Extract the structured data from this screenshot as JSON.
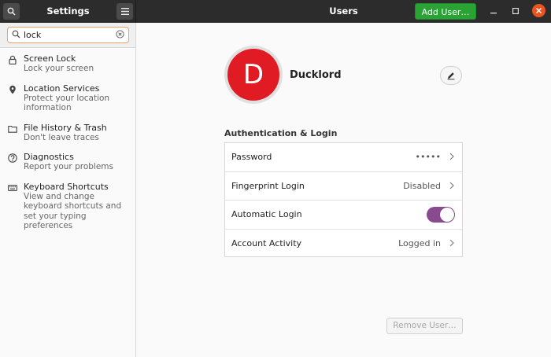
{
  "header": {
    "sidebar_title": "Settings",
    "main_title": "Users",
    "add_user_label": "Add User…"
  },
  "search": {
    "value": "lock",
    "placeholder": ""
  },
  "results": [
    {
      "title": "Screen Lock",
      "sub": "Lock your screen",
      "icon": "lock-icon"
    },
    {
      "title": "Location Services",
      "sub": "Protect your location information",
      "icon": "location-pin-icon"
    },
    {
      "title": "File History & Trash",
      "sub": "Don't leave traces",
      "icon": "folder-icon"
    },
    {
      "title": "Diagnostics",
      "sub": "Report your problems",
      "icon": "question-icon"
    },
    {
      "title": "Keyboard Shortcuts",
      "sub": "View and change keyboard shortcuts and set your typing preferences",
      "icon": "keyboard-icon"
    }
  ],
  "user": {
    "avatar_letter": "D",
    "name": "Ducklord",
    "avatar_color": "#e01b24"
  },
  "auth": {
    "section_title": "Authentication & Login",
    "rows": [
      {
        "label": "Password",
        "value": "•••••"
      },
      {
        "label": "Fingerprint Login",
        "value": "Disabled"
      },
      {
        "label": "Automatic Login",
        "value": "",
        "toggle": true
      },
      {
        "label": "Account Activity",
        "value": "Logged in"
      }
    ]
  },
  "remove_user_label": "Remove User…",
  "colors": {
    "accent_green": "#2aa335",
    "toggle_on": "#8a4a8f",
    "close_orange": "#e95420",
    "search_focus": "#e9a368"
  }
}
